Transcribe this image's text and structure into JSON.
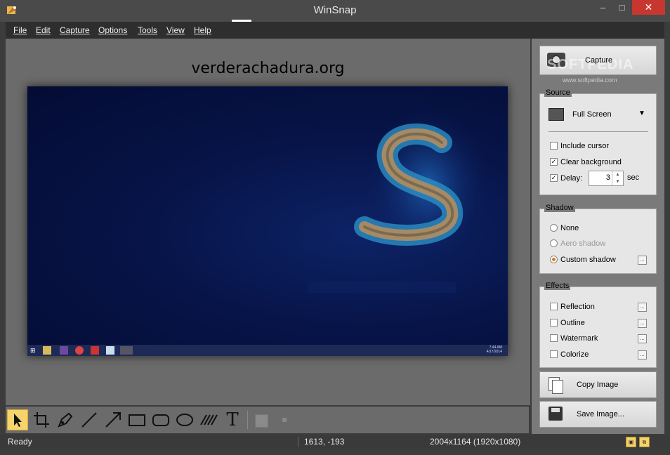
{
  "window": {
    "title": "WinSnap",
    "minimize": "–",
    "maximize": "□",
    "close": "✕"
  },
  "menu": [
    "File",
    "Edit",
    "Capture",
    "Options",
    "Tools",
    "View",
    "Help"
  ],
  "canvas": {
    "site_text": "verderachadura.org",
    "screenshot": {
      "taskbar_clock_time": "7:44 AM",
      "taskbar_clock_date": "4/17/2014"
    }
  },
  "sidebar": {
    "capture_label": "Capture",
    "watermark": "SOFTPEDIA",
    "watermark_url": "www.softpedia.com",
    "source": {
      "title": "Source",
      "mode": "Full Screen",
      "include_cursor": {
        "label": "Include cursor",
        "checked": false
      },
      "clear_background": {
        "label": "Clear background",
        "checked": true
      },
      "delay": {
        "label": "Delay:",
        "checked": true,
        "value": "3",
        "unit": "sec"
      }
    },
    "shadow": {
      "title": "Shadow",
      "options": [
        {
          "label": "None",
          "selected": false,
          "enabled": true
        },
        {
          "label": "Aero shadow",
          "selected": false,
          "enabled": false
        },
        {
          "label": "Custom shadow",
          "selected": true,
          "enabled": true
        }
      ]
    },
    "effects": {
      "title": "Effects",
      "items": [
        {
          "label": "Reflection",
          "checked": false
        },
        {
          "label": "Outline",
          "checked": false
        },
        {
          "label": "Watermark",
          "checked": false
        },
        {
          "label": "Colorize",
          "checked": false
        }
      ]
    },
    "copy_label": "Copy Image",
    "save_label": "Save Image..."
  },
  "tools": [
    "select-tool",
    "crop-tool",
    "pen-tool",
    "line-tool",
    "arrow-tool",
    "rectangle-tool",
    "rounded-rectangle-tool",
    "ellipse-tool",
    "hatch-tool",
    "text-tool",
    "fill-color",
    "stroke-size"
  ],
  "status": {
    "state": "Ready",
    "coords": "1613, -193",
    "size": "2004x1164 (1920x1080)"
  },
  "colors": {
    "accent": "#f5d36d",
    "close_red": "#c7372f",
    "selected_radio": "#e07b10"
  }
}
